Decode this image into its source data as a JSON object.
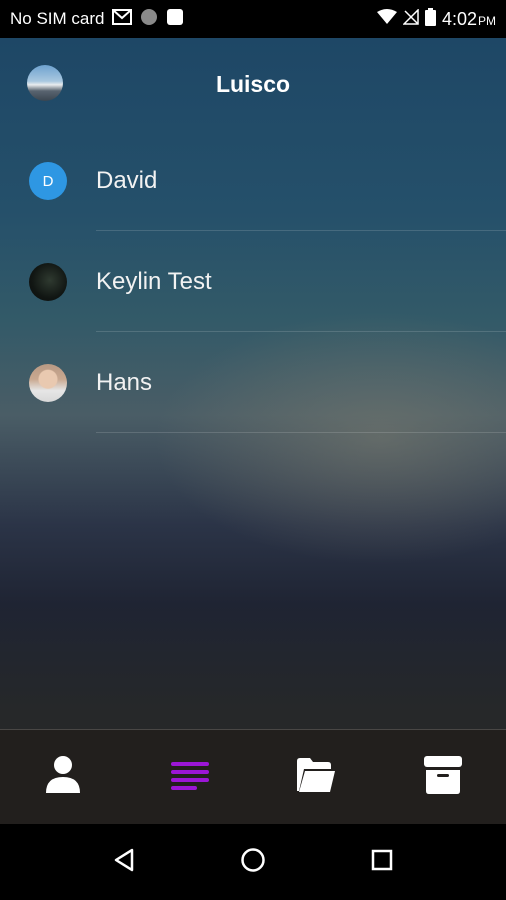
{
  "status_bar": {
    "carrier": "No SIM card",
    "time": "4:02",
    "ampm": "PM",
    "icons": [
      "gmail-icon",
      "circle-notification-icon",
      "square-notification-icon",
      "wifi-icon",
      "no-signal-icon",
      "battery-icon"
    ]
  },
  "header": {
    "title": "Luisco",
    "avatar_icon": "profile-avatar"
  },
  "contacts": [
    {
      "name": "David",
      "avatar_letter": "D",
      "avatar_type": "letter",
      "avatar_color": "#2e97e3"
    },
    {
      "name": "Keylin Test",
      "avatar_letter": "",
      "avatar_type": "photo-dark"
    },
    {
      "name": "Hans",
      "avatar_letter": "",
      "avatar_type": "photo-person"
    }
  ],
  "bottom_nav": {
    "items": [
      {
        "icon": "person-icon",
        "active": false
      },
      {
        "icon": "list-lines-icon",
        "active": true
      },
      {
        "icon": "folder-open-icon",
        "active": false
      },
      {
        "icon": "archive-box-icon",
        "active": false
      }
    ],
    "active_color": "#9b16d6",
    "inactive_color": "#ffffff"
  },
  "system_nav": {
    "icons": [
      "back-icon",
      "home-icon",
      "recents-icon"
    ]
  }
}
